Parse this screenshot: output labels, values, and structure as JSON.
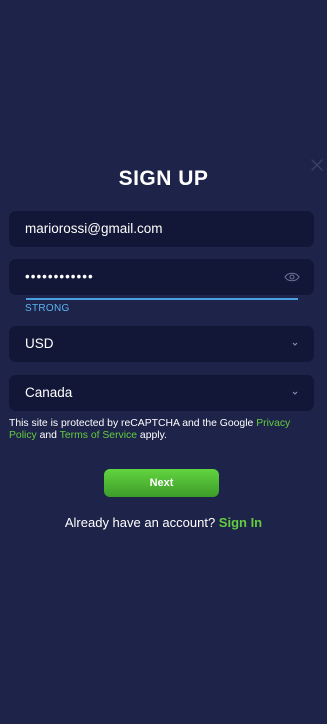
{
  "title": "SIGN UP",
  "email": {
    "value": "mariorossi@gmail.com"
  },
  "password": {
    "masked_value": "••••••••••••",
    "strength_label": "STRONG",
    "strength_color": "#4a9fe0"
  },
  "currency": {
    "selected": "USD"
  },
  "country": {
    "selected": "Canada"
  },
  "legal": {
    "prefix": "This site is protected by reCAPTCHA and the Google ",
    "privacy_link": "Privacy Policy",
    "and": " and ",
    "terms_link": "Terms of Service",
    "suffix": " apply."
  },
  "next_button_label": "Next",
  "signin": {
    "prompt": "Already have an account? ",
    "link": "Sign In"
  },
  "colors": {
    "background": "#1e2349",
    "field": "#121737",
    "accent_green": "#63cd3f",
    "accent_blue": "#4a9fe0"
  },
  "icons": [
    "close-icon",
    "eye-icon",
    "chevron-down-icon"
  ]
}
